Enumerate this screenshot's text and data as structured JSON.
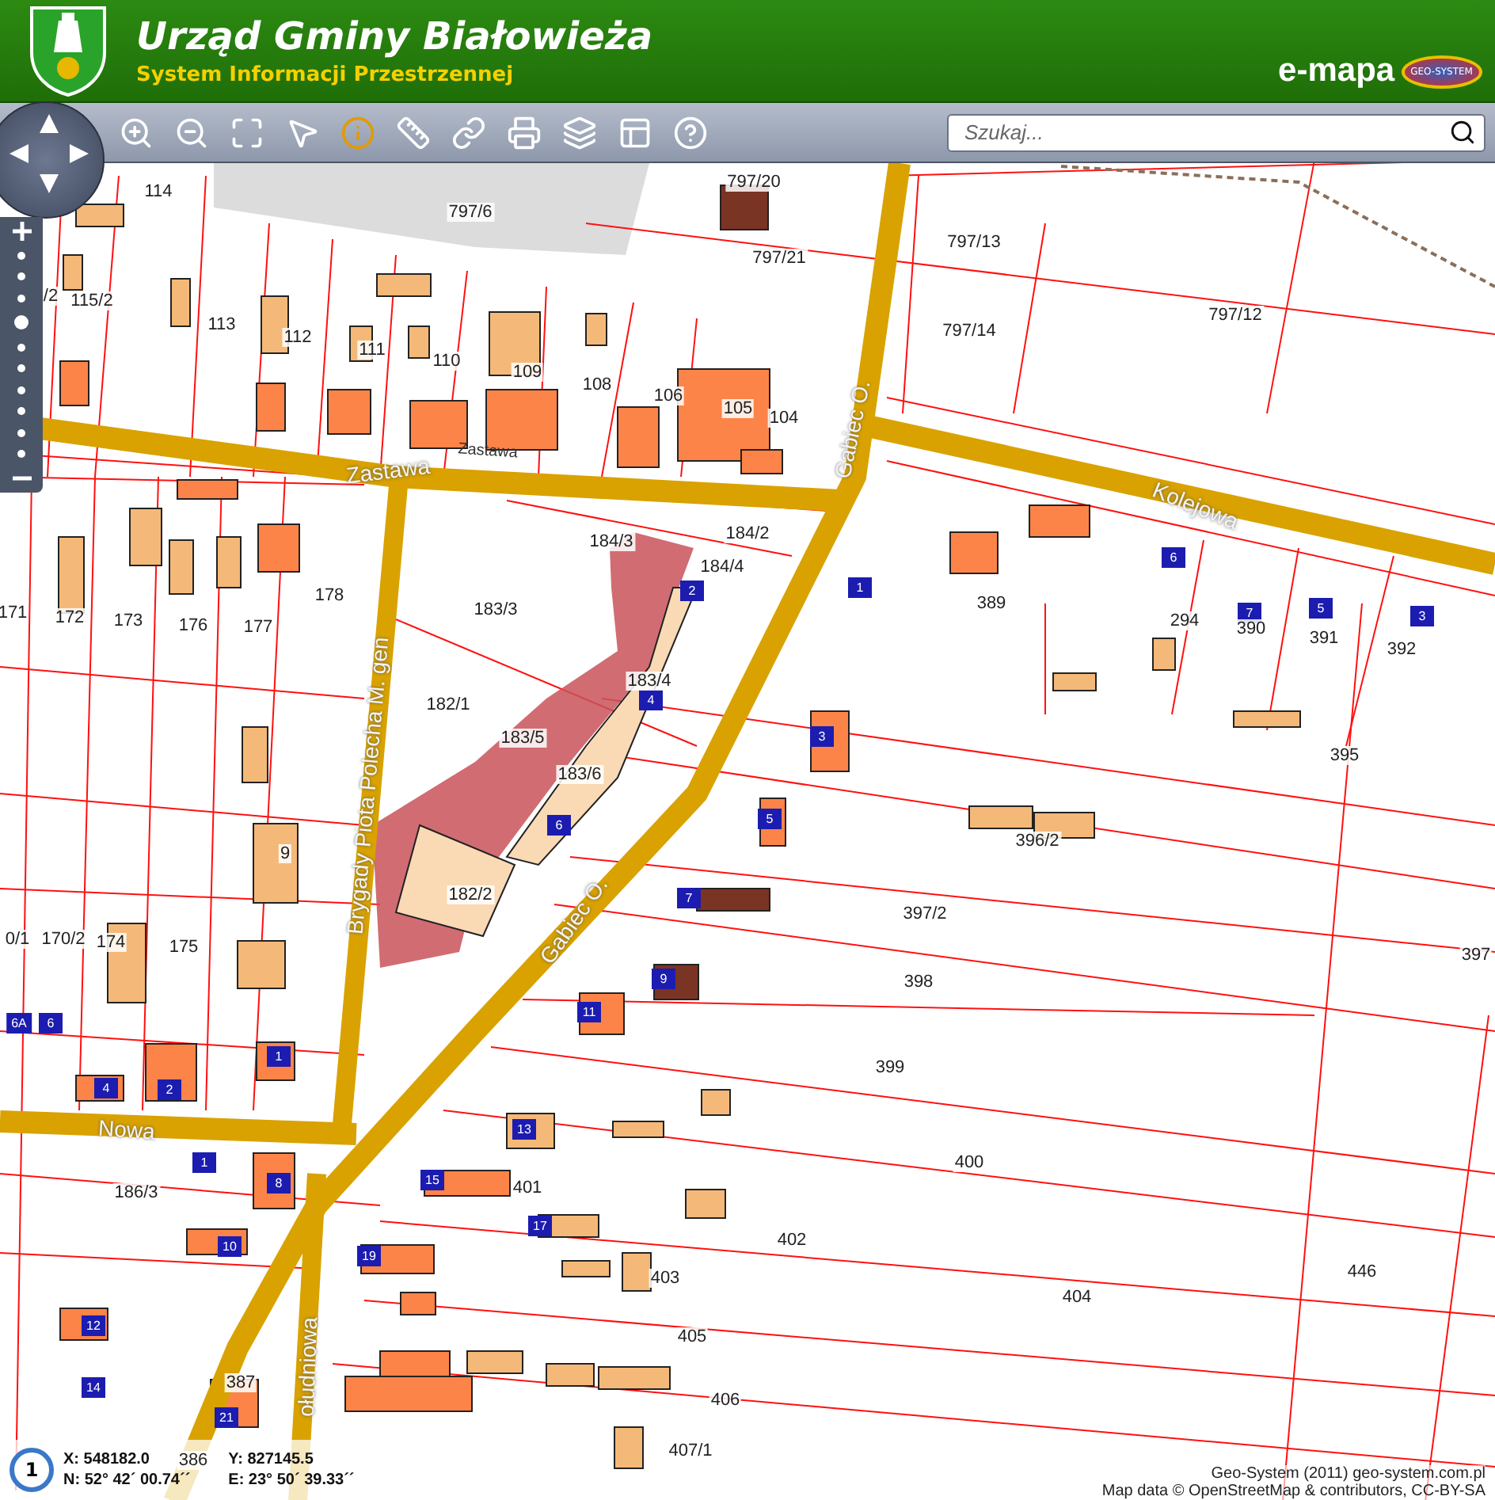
{
  "header": {
    "title": "Urząd Gminy Białowieża",
    "subtitle": "System Informacji Przestrzennej",
    "brand": "e-mapa",
    "brand_logo": "GEO-SYSTEM"
  },
  "toolbar": {
    "search": {
      "placeholder": "Szukaj..."
    }
  },
  "zoom": {
    "level": 0.667
  },
  "map": {
    "streets": [
      "Zastawa",
      "Zastawa",
      "Kolejowa",
      "Gabiec O.",
      "Gabiec O.",
      "Brygady Piota Polecha M. gen",
      "Nowa",
      "ołudniowa"
    ],
    "parcels": [
      "114",
      "797/6",
      "797/20",
      "797/21",
      "797/13",
      "797/14",
      "797/12",
      "/2",
      "115/2",
      "113",
      "112",
      "111",
      "110",
      "109",
      "108",
      "106",
      "105",
      "104",
      "184/3",
      "184/2",
      "184/4",
      "171",
      "172",
      "173",
      "176",
      "177",
      "178",
      "183/3",
      "389",
      "294",
      "390",
      "391",
      "392",
      "182/1",
      "183/4",
      "183/5",
      "183/6",
      "395",
      "396/2",
      "182/2",
      "397/2",
      "398",
      "399",
      "400",
      "401",
      "402",
      "403",
      "404",
      "405",
      "406",
      "407/1",
      "446",
      "397",
      "0/1",
      "170/2",
      "174",
      "175",
      "186/3",
      "387",
      "386",
      "9"
    ],
    "addresses": [
      "2",
      "4",
      "6",
      "1",
      "6",
      "7",
      "5",
      "3",
      "3",
      "5",
      "7",
      "9",
      "11",
      "13",
      "15",
      "17",
      "19",
      "1",
      "2",
      "4",
      "6",
      "6A",
      "1",
      "8",
      "10",
      "12",
      "14",
      "21"
    ]
  },
  "scale": {
    "label": "1"
  },
  "coordinates": {
    "x": "X: 548182.0",
    "y": "Y: 827145.5",
    "n": "N: 52° 42´ 00.74´´",
    "e": "E: 23° 50´ 39.33´´"
  },
  "attribution": [
    "Geo-System (2011) geo-system.com.pl",
    "Map data © OpenStreetMap & contributors, CC-BY-SA"
  ]
}
